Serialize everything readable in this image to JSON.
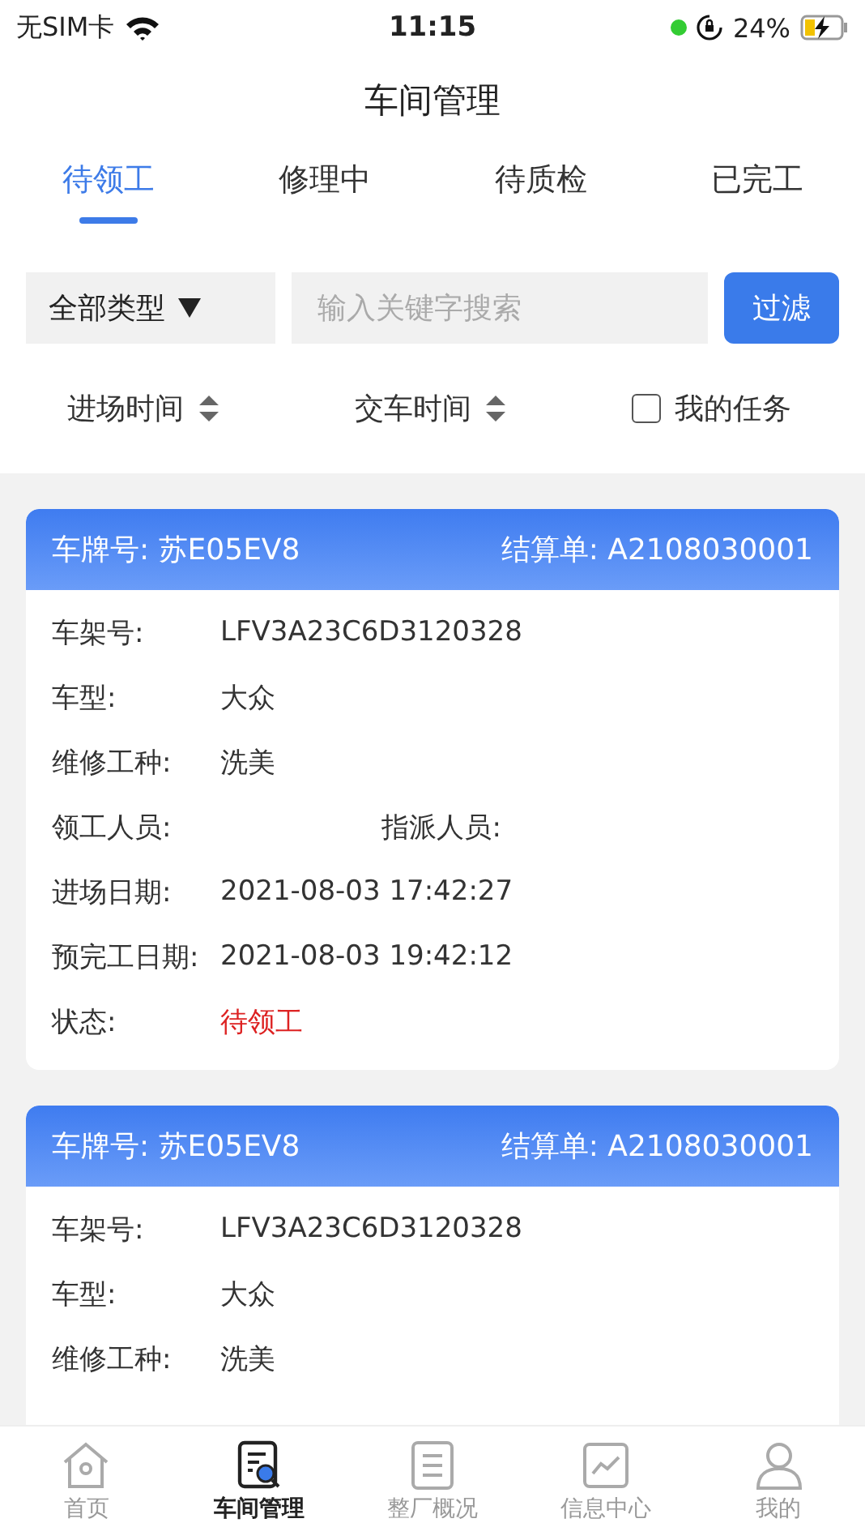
{
  "status_bar": {
    "carrier": "无SIM卡",
    "time": "11:15",
    "battery": "24%"
  },
  "title": "车间管理",
  "tabs": [
    {
      "label": "待领工",
      "selected": true
    },
    {
      "label": "修理中",
      "selected": false
    },
    {
      "label": "待质检",
      "selected": false
    },
    {
      "label": "已完工",
      "selected": false
    }
  ],
  "filter": {
    "type_select": "全部类型",
    "search": {
      "placeholder": "输入关键字搜索"
    },
    "button": "过滤"
  },
  "sort": [
    {
      "label": "进场时间",
      "kind": "sort"
    },
    {
      "label": "交车时间",
      "kind": "sort"
    },
    {
      "label": "我的任务",
      "kind": "checkbox",
      "checked": false
    }
  ],
  "cards": [
    {
      "plate": "车牌号: 苏E05EV8",
      "order": "结算单: A2108030001",
      "fields": [
        {
          "kind": "text",
          "label": "车架号:",
          "value": "LFV3A23C6D3120328"
        },
        {
          "kind": "text",
          "label": "车型:",
          "value": "大众"
        },
        {
          "kind": "text",
          "label": "维修工种:",
          "value": "洗美"
        },
        {
          "kind": "pair",
          "label": "领工人员:",
          "second_label": "指派人员:"
        },
        {
          "kind": "text",
          "label": "进场日期:",
          "value": "2021-08-03 17:42:27"
        },
        {
          "kind": "text",
          "label": "预完工日期:",
          "value": "2021-08-03 19:42:12"
        },
        {
          "kind": "status",
          "label": "状态:",
          "value": "待领工"
        }
      ]
    },
    {
      "plate": "车牌号: 苏E05EV8",
      "order": "结算单: A2108030001",
      "fields": [
        {
          "kind": "text",
          "label": "车架号:",
          "value": "LFV3A23C6D3120328"
        },
        {
          "kind": "text",
          "label": "车型:",
          "value": "大众"
        },
        {
          "kind": "text",
          "label": "维修工种:",
          "value": "洗美"
        }
      ]
    }
  ],
  "nav": [
    {
      "label": "首页",
      "kind": "home",
      "selected": false
    },
    {
      "label": "车间管理",
      "kind": "inspect",
      "selected": true
    },
    {
      "label": "整厂概况",
      "kind": "doc",
      "selected": false
    },
    {
      "label": "信息中心",
      "kind": "chart",
      "selected": false
    },
    {
      "label": "我的",
      "kind": "user",
      "selected": false
    }
  ]
}
